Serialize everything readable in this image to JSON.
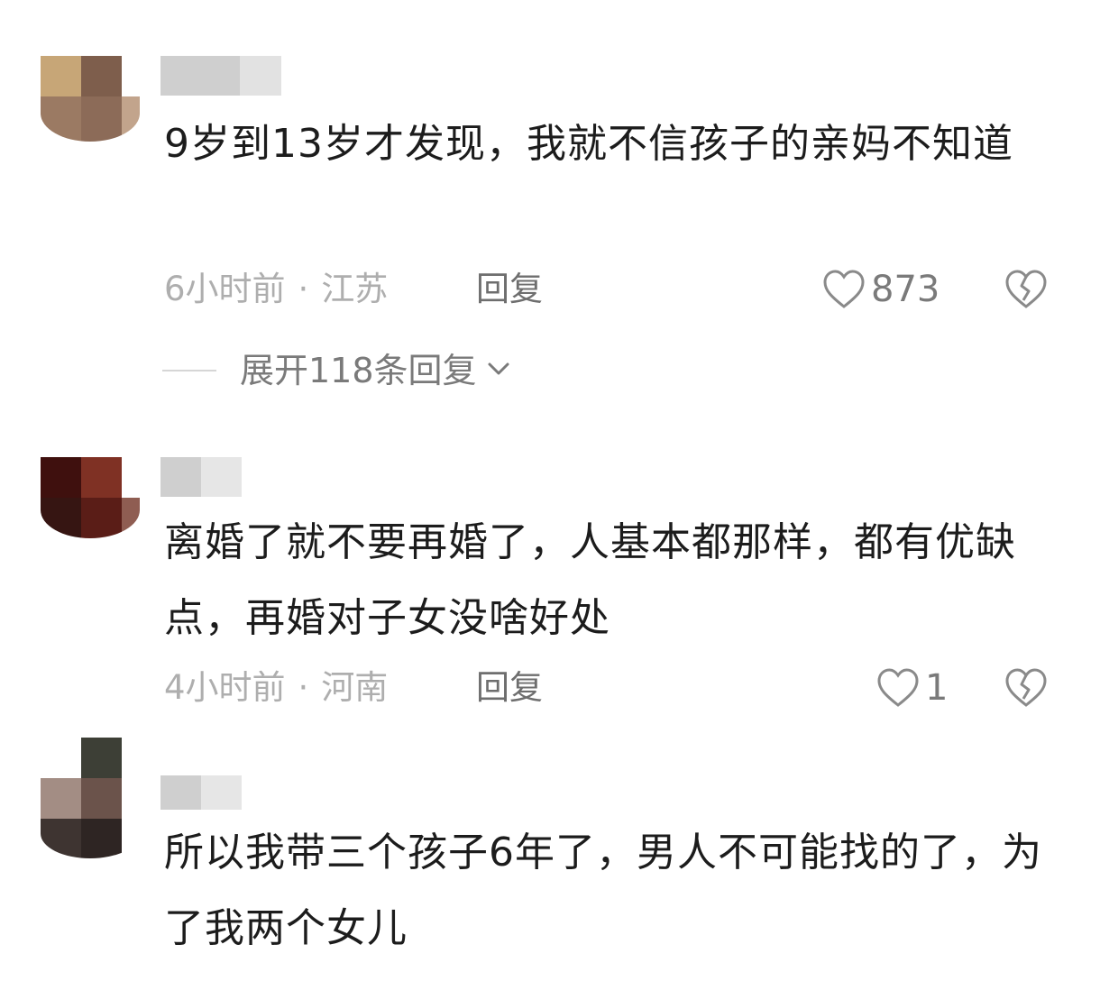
{
  "comments": [
    {
      "text": "9岁到13岁才发现，我就不信孩子的亲妈不知道",
      "time": "6小时前",
      "location": "江苏",
      "reply_label": "回复",
      "likes": "873",
      "expand_label": "展开118条回复"
    },
    {
      "text": "离婚了就不要再婚了，人基本都那样，都有优缺点，再婚对子女没啥好处",
      "time": "4小时前",
      "location": "河南",
      "reply_label": "回复",
      "likes": "1"
    },
    {
      "text": "所以我带三个孩子6年了，男人不可能找的了，为了我两个女儿"
    }
  ],
  "separator": "·",
  "icons": {
    "like": "heart-outline-icon",
    "dislike": "broken-heart-icon",
    "expand": "chevron-down-icon"
  },
  "colors": {
    "text": "#1c1c1c",
    "meta": "#aeaeae",
    "reply": "#6e6e6e"
  }
}
